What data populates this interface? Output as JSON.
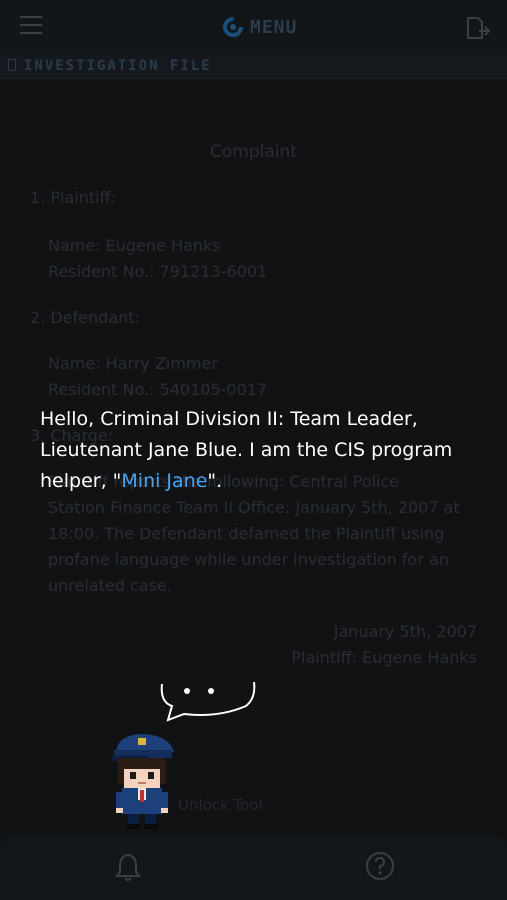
{
  "header": {
    "menu_label": "MENU"
  },
  "file_bar": {
    "label": "INVESTIGATION FILE"
  },
  "document": {
    "title": "Complaint",
    "plaintiff_heading": "1. Plaintiff:",
    "plaintiff_name": "Name: Eugene Hanks",
    "plaintiff_resident": "Resident No.: 791213-6001",
    "defendant_heading": "2. Defendant:",
    "defendant_name": "Name: Harry Zimmer",
    "defendant_resident": "Resident No.: 540105-0017",
    "charge_heading": "3. Charge:",
    "charge_line1": "Plaintiff reports the following: Central Police",
    "charge_line2": "Station Finance Team II Office: January 5th, 2007 at",
    "charge_line3": "18:00. The Defendant defamed the Plaintiff using",
    "charge_line4": "profane language while under investigation for an",
    "charge_line5": "unrelated case.",
    "date": "January 5th, 2007",
    "signature": "Plaintiff: Eugene Hanks"
  },
  "dialog": {
    "line1": "Hello, Criminal Division II: Team Leader,",
    "line2": "Lieutenant Jane Blue. I am the CIS program",
    "line3_pre": "helper, \"",
    "highlight": "Mini Jane",
    "line3_post": "\"."
  },
  "behind_text": "Unlock Tool",
  "icons": {
    "hamburger": "hamburger-menu-icon",
    "menu_logo": "circular-logo-icon",
    "export": "export-file-icon",
    "file": "file-icon",
    "bell": "bell-icon",
    "help": "question-icon"
  },
  "colors": {
    "background": "#101214",
    "highlight": "#4aa3f0",
    "logo": "#1a4f7a"
  }
}
